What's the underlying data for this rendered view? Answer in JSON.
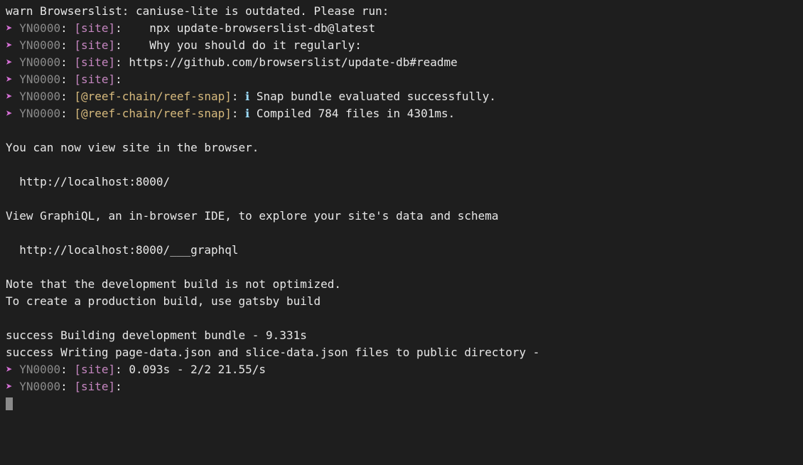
{
  "symbols": {
    "arrow": "➤",
    "info": "ℹ"
  },
  "labels": {
    "yn_code": "YN0000",
    "colon": ": ",
    "site_bracket": "[site]",
    "reef_bracket": "[@reef-chain/reef-snap]"
  },
  "lines": {
    "warn": "warn Browserslist: caniuse-lite is outdated. Please run:",
    "l1_text": "   npx update-browserslist-db@latest",
    "l2_text": "   Why you should do it regularly:",
    "l3_text": "https://github.com/browserslist/update-db#readme",
    "l4_text": "",
    "l5_text": " Snap bundle evaluated successfully.",
    "l6_text": " Compiled 784 files in 4301ms.",
    "blank": "",
    "view_site": "You can now view site in the browser.",
    "localhost": "  http://localhost:8000/",
    "graphiql": "View GraphiQL, an in-browser IDE, to explore your site's data and schema",
    "graphql_url": "  http://localhost:8000/___graphql",
    "note1": "Note that the development build is not optimized.",
    "note2": "To create a production build, use gatsby build",
    "success1": "success Building development bundle - 9.331s",
    "success2": "success Writing page-data.json and slice-data.json files to public directory -",
    "l7_text": "0.093s - 2/2 21.55/s",
    "l8_text": ""
  }
}
